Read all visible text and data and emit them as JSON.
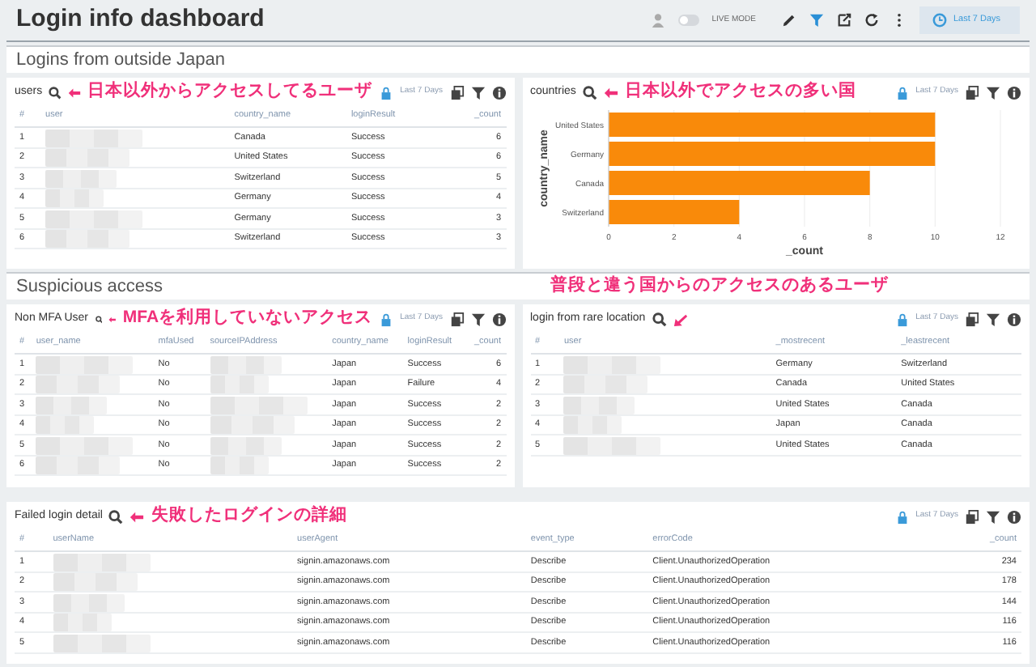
{
  "header": {
    "title": "Login info dashboard",
    "live_mode": {
      "label": "LIVE MODE",
      "on": false
    },
    "time_range": "Last 7 Days"
  },
  "sections": [
    {
      "title": "Logins from outside Japan",
      "panels": [
        {
          "kind": "table",
          "title": "users",
          "annotation": "日本以外からアクセスしてるユーザ",
          "time_range": "Last 7 Days",
          "columns": [
            {
              "label": "#",
              "kind": "text"
            },
            {
              "label": "user",
              "kind": "redacted"
            },
            {
              "label": "country_name",
              "kind": "text"
            },
            {
              "label": "loginResult",
              "kind": "text"
            },
            {
              "label": "_count",
              "kind": "number"
            }
          ],
          "rows": [
            [
              "1",
              "",
              "Canada",
              "Success",
              "6"
            ],
            [
              "2",
              "",
              "United States",
              "Success",
              "6"
            ],
            [
              "3",
              "",
              "Switzerland",
              "Success",
              "5"
            ],
            [
              "4",
              "",
              "Germany",
              "Success",
              "4"
            ],
            [
              "5",
              "",
              "Germany",
              "Success",
              "3"
            ],
            [
              "6",
              "",
              "Switzerland",
              "Success",
              "3"
            ]
          ]
        },
        {
          "kind": "chart",
          "title": "countries",
          "annotation": "日本以外でアクセスの多い国",
          "time_range": "Last 7 Days",
          "chart_data": {
            "type": "bar",
            "orientation": "horizontal",
            "grid": true,
            "xlabel": "_count",
            "ylabel": "country_name",
            "categories": [
              "United States",
              "Germany",
              "Canada",
              "Switzerland"
            ],
            "series": [
              {
                "color": "#f98a0a",
                "values": [
                  10,
                  10,
                  8,
                  4
                ]
              }
            ],
            "xlim": [
              0,
              12
            ],
            "xticks": [
              0,
              2,
              4,
              6,
              8,
              10,
              12
            ]
          }
        }
      ]
    },
    {
      "title": "Suspicious access",
      "annotation": "普段と違う国からのアクセスのあるユーザ",
      "panels": [
        {
          "kind": "table",
          "title": "Non MFA User",
          "annotation": "MFAを利用していないアクセス",
          "time_range": "Last 7 Days",
          "columns": [
            {
              "label": "#",
              "kind": "text"
            },
            {
              "label": "user_name",
              "kind": "redacted"
            },
            {
              "label": "mfaUsed",
              "kind": "text"
            },
            {
              "label": "sourceIPAddress",
              "kind": "redacted"
            },
            {
              "label": "country_name",
              "kind": "text"
            },
            {
              "label": "loginResult",
              "kind": "text"
            },
            {
              "label": "_count",
              "kind": "number"
            }
          ],
          "rows": [
            [
              "1",
              "",
              "No",
              "",
              "Japan",
              "Success",
              "6"
            ],
            [
              "2",
              "",
              "No",
              "",
              "Japan",
              "Failure",
              "4"
            ],
            [
              "3",
              "",
              "No",
              "",
              "Japan",
              "Success",
              "2"
            ],
            [
              "4",
              "",
              "No",
              "",
              "Japan",
              "Success",
              "2"
            ],
            [
              "5",
              "",
              "No",
              "",
              "Japan",
              "Success",
              "2"
            ],
            [
              "6",
              "",
              "No",
              "",
              "Japan",
              "Success",
              "2"
            ]
          ]
        },
        {
          "kind": "table",
          "title": "login from rare location",
          "time_range": "Last 7 Days",
          "columns": [
            {
              "label": "#",
              "kind": "text"
            },
            {
              "label": "user",
              "kind": "redacted"
            },
            {
              "label": "_mostrecent",
              "kind": "text"
            },
            {
              "label": "_leastrecent",
              "kind": "text"
            }
          ],
          "rows": [
            [
              "1",
              "",
              "Germany",
              "Switzerland"
            ],
            [
              "2",
              "",
              "Canada",
              "United States"
            ],
            [
              "3",
              "",
              "United States",
              "Canada"
            ],
            [
              "4",
              "",
              "Japan",
              "Canada"
            ],
            [
              "5",
              "",
              "United States",
              "Canada"
            ]
          ]
        },
        {
          "kind": "table",
          "title": "Failed login detail",
          "annotation": "失敗したログインの詳細",
          "time_range": "Last 7 Days",
          "columns": [
            {
              "label": "#",
              "kind": "text"
            },
            {
              "label": "userName",
              "kind": "redacted"
            },
            {
              "label": "userAgent",
              "kind": "text"
            },
            {
              "label": "event_type",
              "kind": "text"
            },
            {
              "label": "errorCode",
              "kind": "text"
            },
            {
              "label": "_count",
              "kind": "number"
            }
          ],
          "rows": [
            [
              "1",
              "",
              "signin.amazonaws.com",
              "Describe",
              "Client.UnauthorizedOperation",
              "234"
            ],
            [
              "2",
              "",
              "signin.amazonaws.com",
              "Describe",
              "Client.UnauthorizedOperation",
              "178"
            ],
            [
              "3",
              "",
              "signin.amazonaws.com",
              "Describe",
              "Client.UnauthorizedOperation",
              "144"
            ],
            [
              "4",
              "",
              "signin.amazonaws.com",
              "Describe",
              "Client.UnauthorizedOperation",
              "116"
            ],
            [
              "5",
              "",
              "signin.amazonaws.com",
              "Describe",
              "Client.UnauthorizedOperation",
              "116"
            ]
          ]
        }
      ]
    }
  ]
}
